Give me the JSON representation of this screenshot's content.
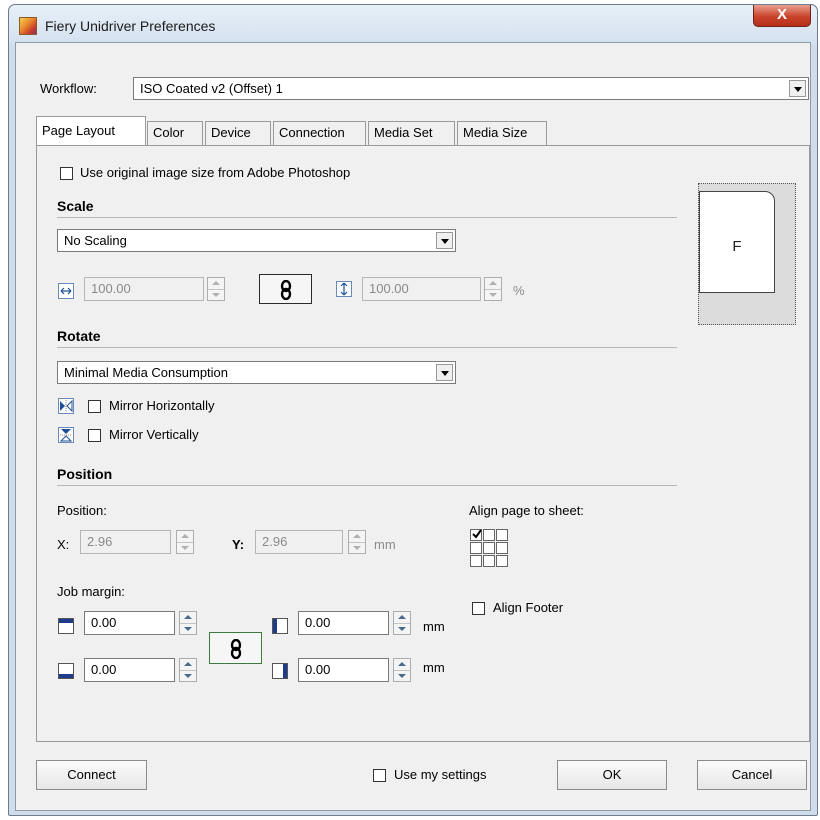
{
  "window": {
    "title": "Fiery Unidriver Preferences",
    "close_label": "X"
  },
  "workflow": {
    "label": "Workflow:",
    "value": "ISO Coated v2 (Offset) 1"
  },
  "tabs": [
    {
      "label": "Page Layout",
      "active": true
    },
    {
      "label": "Color",
      "active": false
    },
    {
      "label": "Device",
      "active": false
    },
    {
      "label": "Connection",
      "active": false
    },
    {
      "label": "Media Set",
      "active": false
    },
    {
      "label": "Media Size",
      "active": false
    }
  ],
  "page_layout": {
    "use_original_size": {
      "label": "Use original image size from Adobe Photoshop",
      "checked": false
    },
    "scale": {
      "title": "Scale",
      "mode": "No Scaling",
      "width_value": "100.00",
      "height_value": "100.00",
      "unit": "%"
    },
    "rotate": {
      "title": "Rotate",
      "mode": "Minimal Media Consumption",
      "mirror_h": {
        "label": "Mirror Horizontally",
        "checked": false
      },
      "mirror_v": {
        "label": "Mirror Vertically",
        "checked": false
      }
    },
    "position": {
      "title": "Position",
      "position_label": "Position:",
      "x_label": "X:",
      "x_value": "2.96",
      "y_label": "Y:",
      "y_value": "2.96",
      "unit": "mm",
      "align_label": "Align page to sheet:",
      "align_grid_selected": "top-left",
      "align_footer": {
        "label": "Align Footer",
        "checked": false
      },
      "job_margin_label": "Job margin:",
      "margin_top": "0.00",
      "margin_bottom": "0.00",
      "margin_left": "0.00",
      "margin_right": "0.00",
      "margin_unit": "mm"
    },
    "preview_letter": "F"
  },
  "footer": {
    "connect_label": "Connect",
    "use_my_settings": {
      "label": "Use my settings",
      "checked": false
    },
    "ok_label": "OK",
    "cancel_label": "Cancel"
  },
  "colors": {
    "titlebar": "#d3e0ee",
    "close_button": "#c9432c",
    "dialog_bg": "#f0f0f0",
    "link_border_green": "#3d7a3d"
  }
}
